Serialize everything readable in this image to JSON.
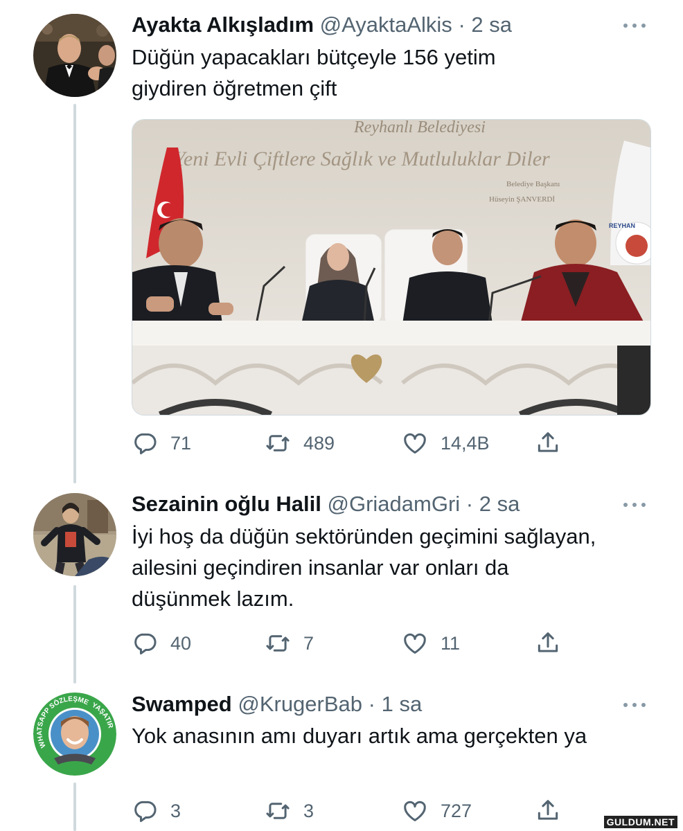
{
  "tweets": [
    {
      "name": "Ayakta Alkışladım",
      "handle": "@AyaktaAlkis",
      "dot": "·",
      "time": "2 sa",
      "text": "Düğün yapacakları bütçeyle 156 yetim giydiren öğretmen çift",
      "media": {
        "banner_line1": "Reyhanlı Belediyesi",
        "banner_line2": "Yeni Evli Çiftlere Sağlık ve Mutluluklar Diler",
        "banner_line3": "Belediye Başkanı",
        "banner_line4": "Hüseyin ŞANVERDİ",
        "flag_text": "REYHAN"
      },
      "replies": "71",
      "retweets": "489",
      "likes": "14,4B"
    },
    {
      "name": "Sezainin oğlu Halil",
      "handle": "@GriadamGri",
      "dot": "·",
      "time": "2 sa",
      "text": "İyi hoş da düğün sektöründen geçimini sağlayan, ailesini geçindiren insanlar var onları da düşünmek lazım.",
      "replies": "40",
      "retweets": "7",
      "likes": "11"
    },
    {
      "name": "Swamped",
      "handle": "@KrugerBab",
      "dot": "·",
      "time": "1 sa",
      "text": "Yok anasının amı duyarı artık ama gerçekten ya",
      "avatar_ring_text_left": "WHATSAPP SÖZLEŞMESİ",
      "avatar_ring_text_right": "YAŞATIR",
      "replies": "3",
      "retweets": "3",
      "likes": "727"
    }
  ],
  "watermark": "GULDUM.NET"
}
